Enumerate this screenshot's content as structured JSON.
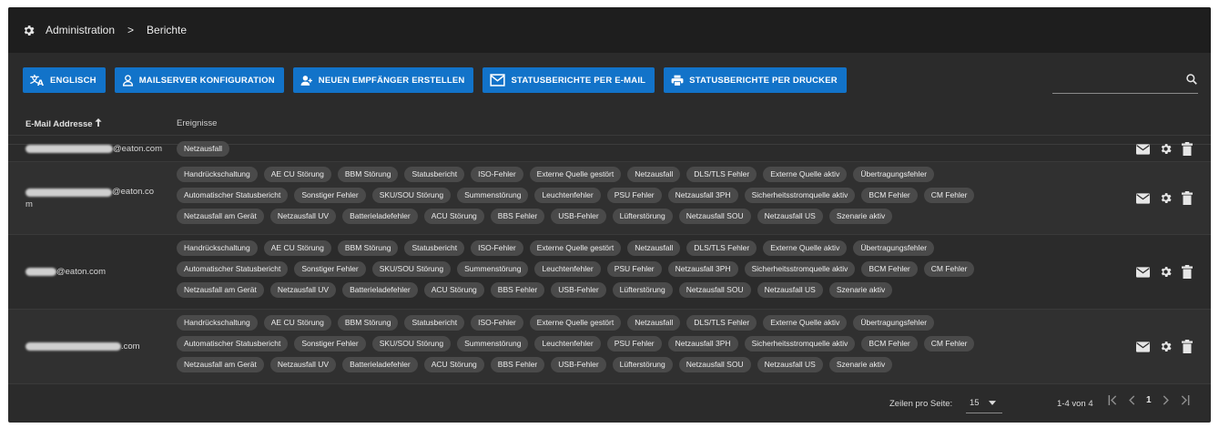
{
  "breadcrumb": {
    "root": "Administration",
    "separator": ">",
    "current": "Berichte"
  },
  "toolbar": {
    "buttons": [
      {
        "label": "Englisch",
        "icon": "translate-icon"
      },
      {
        "label": "Mailserver Konfiguration",
        "icon": "person-icon"
      },
      {
        "label": "Neuen Empfänger erstellen",
        "icon": "add-person-icon"
      },
      {
        "label": "Statusberichte per E-Mail",
        "icon": "mail-outline-icon"
      },
      {
        "label": "Statusberichte per Drucker",
        "icon": "printer-icon"
      }
    ],
    "search_icon": "search-icon"
  },
  "table": {
    "columns": {
      "email": "E-Mail Addresse",
      "events": "Ereignisse"
    },
    "sort_icon": "arrow-up-icon",
    "rows": [
      {
        "email_suffix": "@eaton.com",
        "events": [
          [
            "Netzausfall"
          ]
        ]
      },
      {
        "email_suffix": "@eaton.co",
        "email_wrap": "m",
        "events": [
          [
            "Handrückschaltung",
            "AE CU Störung",
            "BBM Störung",
            "Statusbericht",
            "ISO-Fehler",
            "Externe Quelle gestört",
            "Netzausfall",
            "DLS/TLS Fehler",
            "Externe Quelle aktiv",
            "Übertragungsfehler"
          ],
          [
            "Automatischer Statusbericht",
            "Sonstiger Fehler",
            "SKU/SOU Störung",
            "Summenstörung",
            "Leuchtenfehler",
            "PSU Fehler",
            "Netzausfall 3PH",
            "Sicherheitsstromquelle aktiv",
            "BCM Fehler",
            "CM Fehler"
          ],
          [
            "Netzausfall am Gerät",
            "Netzausfall UV",
            "Batterieladefehler",
            "ACU Störung",
            "BBS Fehler",
            "USB-Fehler",
            "Lüfterstörung",
            "Netzausfall SOU",
            "Netzausfall US",
            "Szenarie aktiv"
          ]
        ]
      },
      {
        "email_suffix": "@eaton.com",
        "events": [
          [
            "Handrückschaltung",
            "AE CU Störung",
            "BBM Störung",
            "Statusbericht",
            "ISO-Fehler",
            "Externe Quelle gestört",
            "Netzausfall",
            "DLS/TLS Fehler",
            "Externe Quelle aktiv",
            "Übertragungsfehler"
          ],
          [
            "Automatischer Statusbericht",
            "Sonstiger Fehler",
            "SKU/SOU Störung",
            "Summenstörung",
            "Leuchtenfehler",
            "PSU Fehler",
            "Netzausfall 3PH",
            "Sicherheitsstromquelle aktiv",
            "BCM Fehler",
            "CM Fehler"
          ],
          [
            "Netzausfall am Gerät",
            "Netzausfall UV",
            "Batterieladefehler",
            "ACU Störung",
            "BBS Fehler",
            "USB-Fehler",
            "Lüfterstörung",
            "Netzausfall SOU",
            "Netzausfall US",
            "Szenarie aktiv"
          ]
        ]
      },
      {
        "email_suffix": ".com",
        "events": [
          [
            "Handrückschaltung",
            "AE CU Störung",
            "BBM Störung",
            "Statusbericht",
            "ISO-Fehler",
            "Externe Quelle gestört",
            "Netzausfall",
            "DLS/TLS Fehler",
            "Externe Quelle aktiv",
            "Übertragungsfehler"
          ],
          [
            "Automatischer Statusbericht",
            "Sonstiger Fehler",
            "SKU/SOU Störung",
            "Summenstörung",
            "Leuchtenfehler",
            "PSU Fehler",
            "Netzausfall 3PH",
            "Sicherheitsstromquelle aktiv",
            "BCM Fehler",
            "CM Fehler"
          ],
          [
            "Netzausfall am Gerät",
            "Netzausfall UV",
            "Batterieladefehler",
            "ACU Störung",
            "BBS Fehler",
            "USB-Fehler",
            "Lüfterstörung",
            "Netzausfall SOU",
            "Netzausfall US",
            "Szenarie aktiv"
          ]
        ]
      }
    ],
    "row_actions": [
      "mail-icon",
      "gear-icon",
      "trash-icon"
    ]
  },
  "footer": {
    "rows_per_page_label": "Zeilen pro Seite:",
    "rows_per_page_value": "15",
    "range": "1-4 von 4",
    "current_page": "1",
    "nav_icons": [
      "first-page-icon",
      "prev-page-icon",
      "next-page-icon",
      "last-page-icon"
    ]
  },
  "colors": {
    "accent": "#1273c9",
    "background": "#2b2b2b",
    "header": "#1e1e1e",
    "chip": "#4a4a4a"
  }
}
